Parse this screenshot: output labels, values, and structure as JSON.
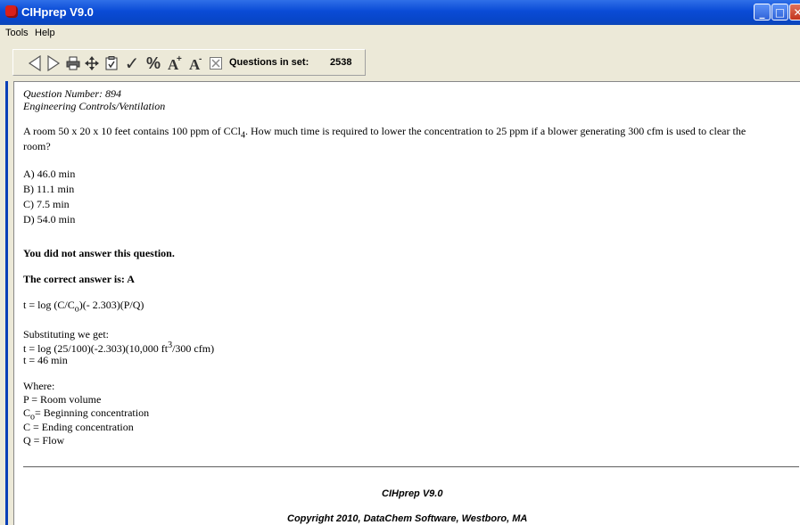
{
  "window": {
    "title": "CIHprep V9.0",
    "min_glyph": "_",
    "max_glyph": "□",
    "close_glyph": "✕"
  },
  "menu": {
    "tools": "Tools",
    "help": "Help"
  },
  "toolbar": {
    "questions_label": "Questions in set:",
    "questions_count": "2538",
    "percent_label": "%",
    "check_label": "✓",
    "printer_icon": "printer-icon",
    "move_icon": "move-icon",
    "clipboard_icon": "clipboard-check-icon",
    "font_icon": "font-size-icon",
    "close_icon": "close-icon"
  },
  "question": {
    "number_line": "Question Number: 894",
    "category": "Engineering Controls/Ventilation",
    "text_part1": "A room 50 x 20 x 10 feet contains 100 ppm of CCl",
    "text_sub": "4",
    "text_part2": ". How much time is required to lower the concentration to 25 ppm if a blower generating 300 cfm is used to clear the",
    "text_line2": "room?",
    "options": [
      "A) 46.0 min",
      "B) 11.1 min",
      "C) 7.5 min",
      "D) 54.0 min"
    ]
  },
  "result": {
    "status": "You did not answer this question.",
    "correct_answer": "The correct answer is: A"
  },
  "explanation": {
    "formula_a": "t = log (C/C",
    "formula_sub": "o",
    "formula_b": ")(- 2.303)(P/Q)",
    "sub_heading": "Substituting we get:",
    "sub_line1_a": "t = log (25/100)(-2.303)(10,000 ft",
    "sub_line1_sup": "3",
    "sub_line1_b": "/300 cfm)",
    "sub_line2": "t = 46 min",
    "where_heading": "Where:",
    "where1": "P = Room volume",
    "where2_a": "C",
    "where2_sub": "o",
    "where2_b": "= Beginning concentration",
    "where3": "C = Ending concentration",
    "where4": "Q = Flow"
  },
  "footer": {
    "app_name": "CIHprep V9.0",
    "copyright": "Copyright 2010, DataChem Software, Westboro, MA"
  }
}
